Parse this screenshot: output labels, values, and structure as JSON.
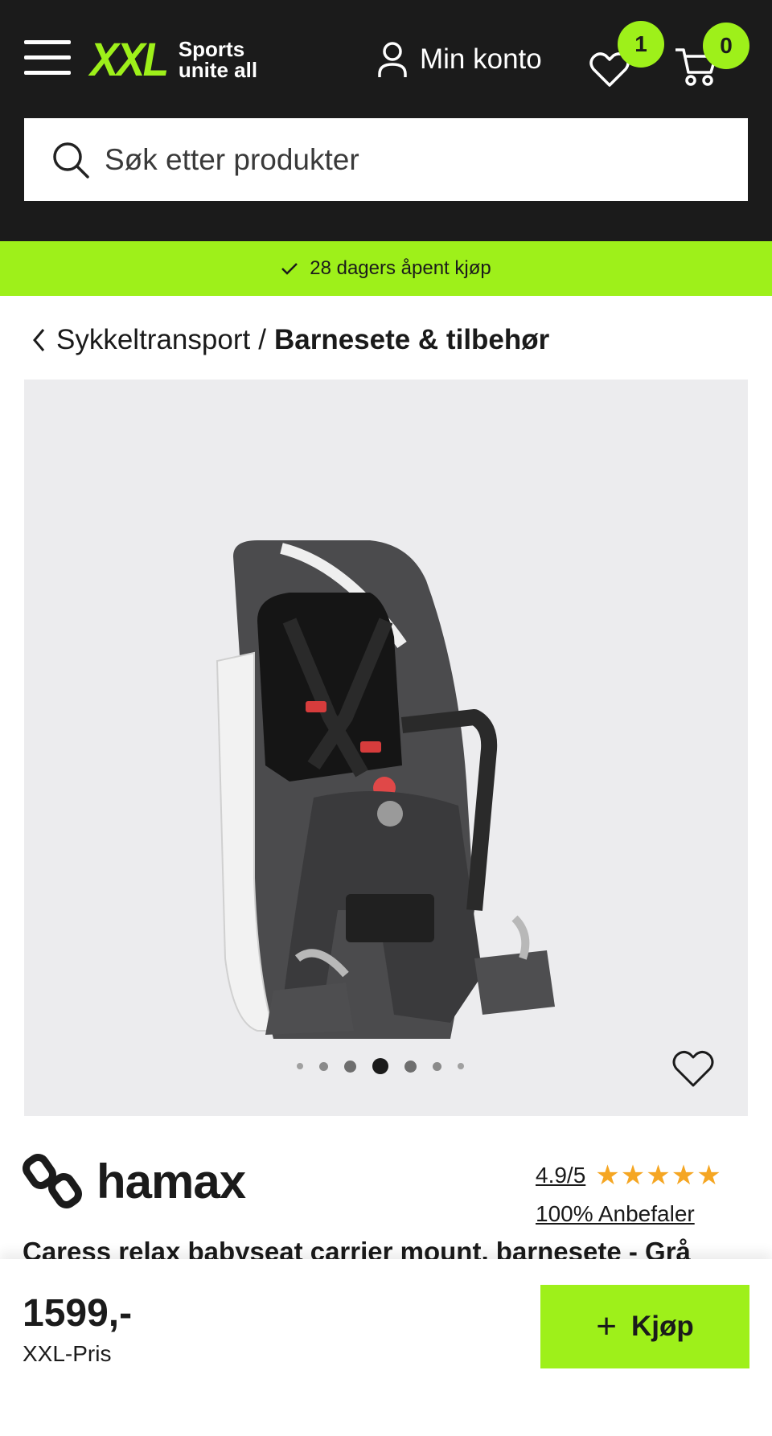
{
  "header": {
    "logo_text": "XXL",
    "logo_tagline_line1": "Sports",
    "logo_tagline_line2": "unite all",
    "account_label": "Min konto",
    "wishlist_count": "1",
    "cart_count": "0",
    "brand_color": "#9ef01a"
  },
  "search": {
    "placeholder": "Søk etter produkter"
  },
  "usp": {
    "text": "28 dagers åpent kjøp"
  },
  "breadcrumb": {
    "parent": "Sykkeltransport",
    "separator": "/",
    "current": "Barnesete & tilbehør"
  },
  "gallery": {
    "dot_count": 7,
    "active_dot": 4
  },
  "product": {
    "brand": "hamax",
    "rating": "4.9/5",
    "stars": "★★★★★",
    "recommend": "100% Anbefaler",
    "title": "Caress relax babyseat carrier mount, barnesete - Grå"
  },
  "buybar": {
    "price": "1599,-",
    "price_label": "XXL-Pris",
    "buy_label": "Kjøp"
  }
}
